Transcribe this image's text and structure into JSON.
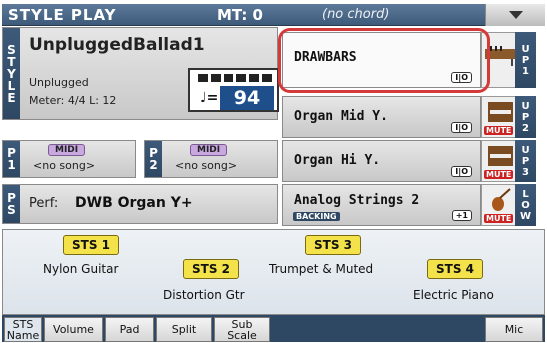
{
  "topbar": {
    "title": "STYLE PLAY",
    "mt": "MT: 0",
    "chord": "(no chord)"
  },
  "style": {
    "side": "STYLE",
    "name": "UnpluggedBallad1",
    "category": "Unplugged",
    "meter": "Meter: 4/4  L: 12",
    "tempo": "94",
    "tempo_note": "♩="
  },
  "songs": [
    {
      "side": "P1",
      "midi": "MIDI",
      "text": "<no song>"
    },
    {
      "side": "P2",
      "midi": "MIDI",
      "text": "<no song>"
    }
  ],
  "perf": {
    "side": "PS",
    "label": "Perf:",
    "name": "DWB Organ Y+"
  },
  "tracks": [
    {
      "name": "DRAWBARS",
      "tag": "I|O",
      "backing": "",
      "mute": "",
      "up": "UP1",
      "icon": "drawbar-organ-icon"
    },
    {
      "name": "Organ Mid Y.",
      "tag": "I|O",
      "backing": "",
      "mute": "MUTE",
      "up": "UP2",
      "icon": "organ-icon"
    },
    {
      "name": "Organ Hi Y.",
      "tag": "I|O",
      "backing": "",
      "mute": "MUTE",
      "up": "UP3",
      "icon": "organ-icon"
    },
    {
      "name": "Analog Strings 2",
      "tag": "+1",
      "backing": "BACKING",
      "mute": "MUTE",
      "up": "LOW",
      "icon": "violin-icon"
    }
  ],
  "sts": [
    {
      "label": "STS 1",
      "name": "Nylon Guitar"
    },
    {
      "label": "STS 2",
      "name": "Distortion Gtr"
    },
    {
      "label": "STS 3",
      "name": "Trumpet & Muted"
    },
    {
      "label": "STS 4",
      "name": "Electric Piano"
    }
  ],
  "tabs": [
    {
      "l1": "STS",
      "l2": "Name"
    },
    {
      "l1": "Volume",
      "l2": ""
    },
    {
      "l1": "Pad",
      "l2": ""
    },
    {
      "l1": "Split",
      "l2": ""
    },
    {
      "l1": "Sub",
      "l2": "Scale"
    },
    {
      "l1": "Mic",
      "l2": ""
    }
  ],
  "colors": {
    "accent": "#3d5a7a",
    "sts": "#f4e24a",
    "highlight": "#d43a3a",
    "tempo": "#1f4f8a",
    "mute": "#cc2222"
  }
}
